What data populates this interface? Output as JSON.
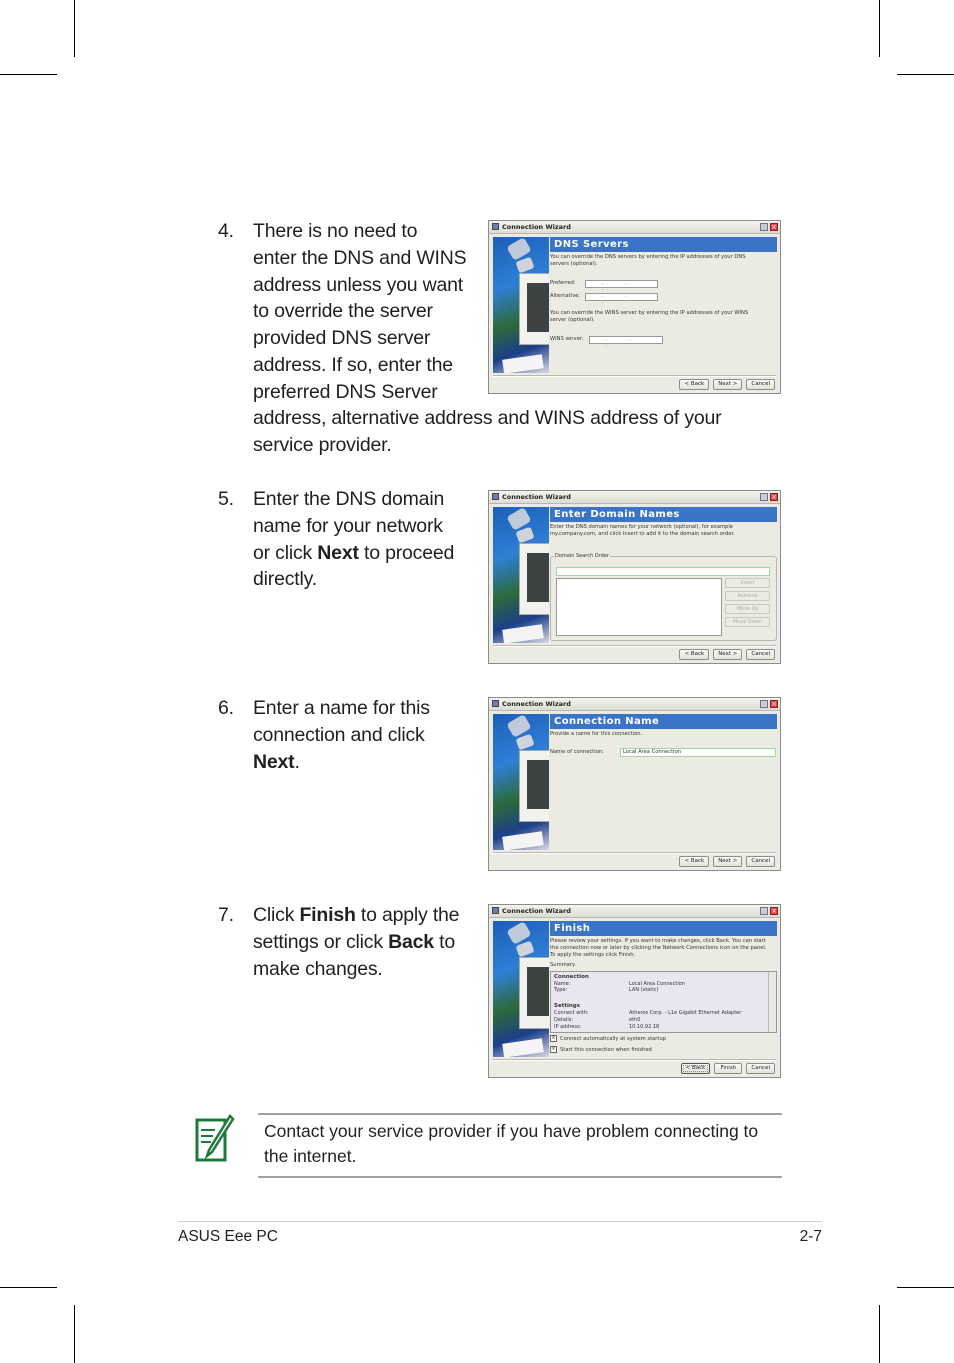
{
  "steps": [
    {
      "number": "4.",
      "lines": [
        "There is no need to",
        "enter the DNS and WINS",
        "address unless you want",
        "to override the server",
        "provided DNS server",
        "address. If so, enter the",
        "preferred DNS Server"
      ],
      "continuation": [
        "address, alternative address and WINS address of your",
        "service provider."
      ]
    },
    {
      "number": "5.",
      "line1": "Enter the DNS domain",
      "line2": "name for your network",
      "line3_pre": "or click ",
      "line3_bold": "Next",
      "line3_post": " to proceed",
      "line4": "directly."
    },
    {
      "number": "6.",
      "line1": "Enter a name for this",
      "line2": "connection and click",
      "line3_bold": "Next",
      "line3_post": "."
    },
    {
      "number": "7.",
      "line1_pre": "Click ",
      "line1_bold": "Finish",
      "line1_post": " to apply the",
      "line2_pre": "settings or click ",
      "line2_bold": "Back",
      "line2_post": " to",
      "line3": "make changes."
    }
  ],
  "wizards": {
    "window_title": "Connection Wizard",
    "buttons": {
      "back": "< Back",
      "next": "Next >",
      "cancel": "Cancel",
      "finish": "Finish"
    },
    "dns": {
      "heading": "DNS Servers",
      "desc": "You can override the DNS servers by entering the IP addresses of your DNS servers (optional).",
      "preferred_label": "Preferred:",
      "alternative_label": "Alternative:",
      "wins_desc": "You can override the WINS server by entering the IP addresses of your WINS server (optional).",
      "wins_label": "WINS server:",
      "ip_placeholder": ". . ."
    },
    "domain": {
      "heading": "Enter Domain Names",
      "desc": "Enter the DNS domain names for your network (optional), for example my.company.com, and click Insert to add it to the domain search order.",
      "group_label": "Domain Search Order",
      "insert": "Insert",
      "remove": "Remove",
      "move_up": "Move Up",
      "move_down": "Move Down"
    },
    "name": {
      "heading": "Connection Name",
      "desc": "Provide a name for this connection.",
      "field_label": "Name of connection:",
      "field_value": "Local Area Connection"
    },
    "finish": {
      "heading": "Finish",
      "desc": "Please review your settings. If you want to make changes, click Back. You can start the connection now or later by clicking the Network Connections icon on the panel. To apply the settings click Finish.",
      "summary_label": "Summary",
      "summary": {
        "connection_title": "Connection",
        "name_label": "Name:",
        "name_value": "Local Area Connection",
        "type_label": "Type:",
        "type_value": "LAN (static)",
        "settings_title": "Settings",
        "connect_with_label": "Connect with:",
        "connect_with_value": "Atheros Corp. - L1e Gigabit Ethernet Adapter",
        "details_label": "Details:",
        "details_value": "eth0",
        "ip_label": "IP address:",
        "ip_value": "10.10.92.18"
      },
      "check_auto": "Connect automatically at system startup",
      "check_start": "Start this connection when finished",
      "check_auto_checked": true,
      "check_start_checked": true
    }
  },
  "note": {
    "icon": "note-pencil-icon",
    "text": "Contact your service provider if you have problem connecting to the internet."
  },
  "footer": {
    "left": "ASUS Eee PC",
    "right": "2-7"
  },
  "colors": {
    "wizard_header": "#3a74c8",
    "note_icon": "#1f7a3a"
  }
}
